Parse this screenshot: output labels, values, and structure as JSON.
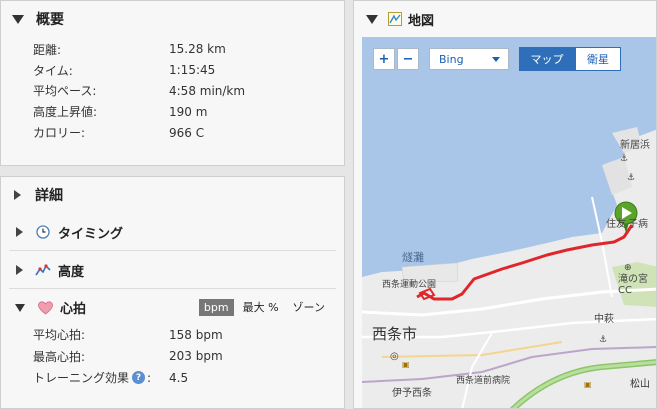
{
  "summary": {
    "title": "概要",
    "rows": [
      {
        "label": "距離:",
        "value": "15.28 km"
      },
      {
        "label": "タイム:",
        "value": "1:15:45"
      },
      {
        "label": "平均ペース:",
        "value": "4:58 min/km"
      },
      {
        "label": "高度上昇値:",
        "value": "190 m"
      },
      {
        "label": "カロリー:",
        "value": "966 C"
      }
    ]
  },
  "details": {
    "title": "詳細",
    "timing_label": "タイミング",
    "elevation_label": "高度",
    "heartrate": {
      "label": "心拍",
      "tabs": [
        "bpm",
        "最大 %",
        "ゾーン"
      ],
      "rows": [
        {
          "label": "平均心拍:",
          "value": "158 bpm"
        },
        {
          "label": "最高心拍:",
          "value": "203 bpm"
        },
        {
          "label": "トレーニング効果",
          "suffix": ":",
          "value": "4.5"
        }
      ]
    }
  },
  "map": {
    "title": "地図",
    "zoom_in": "+",
    "zoom_out": "−",
    "provider": "Bing",
    "btn_map": "マップ",
    "btn_satellite": "衛星",
    "labels": {
      "shinkyo": "新居浜",
      "sumito": "住友",
      "ko": "子病",
      "tsuinada": "燧灘",
      "undo": "西条運動公園",
      "takinomiya": "滝の宮CC",
      "nakahagi": "中萩",
      "saijoshi": "西条市",
      "byoin": "西条道前病院",
      "iyosaijo": "伊予西条",
      "matsuyama": "松山"
    },
    "colors": {
      "sea": "#a9c6e8",
      "land": "#ececec",
      "route": "#e0262b",
      "marker": "#5aa42a"
    }
  }
}
